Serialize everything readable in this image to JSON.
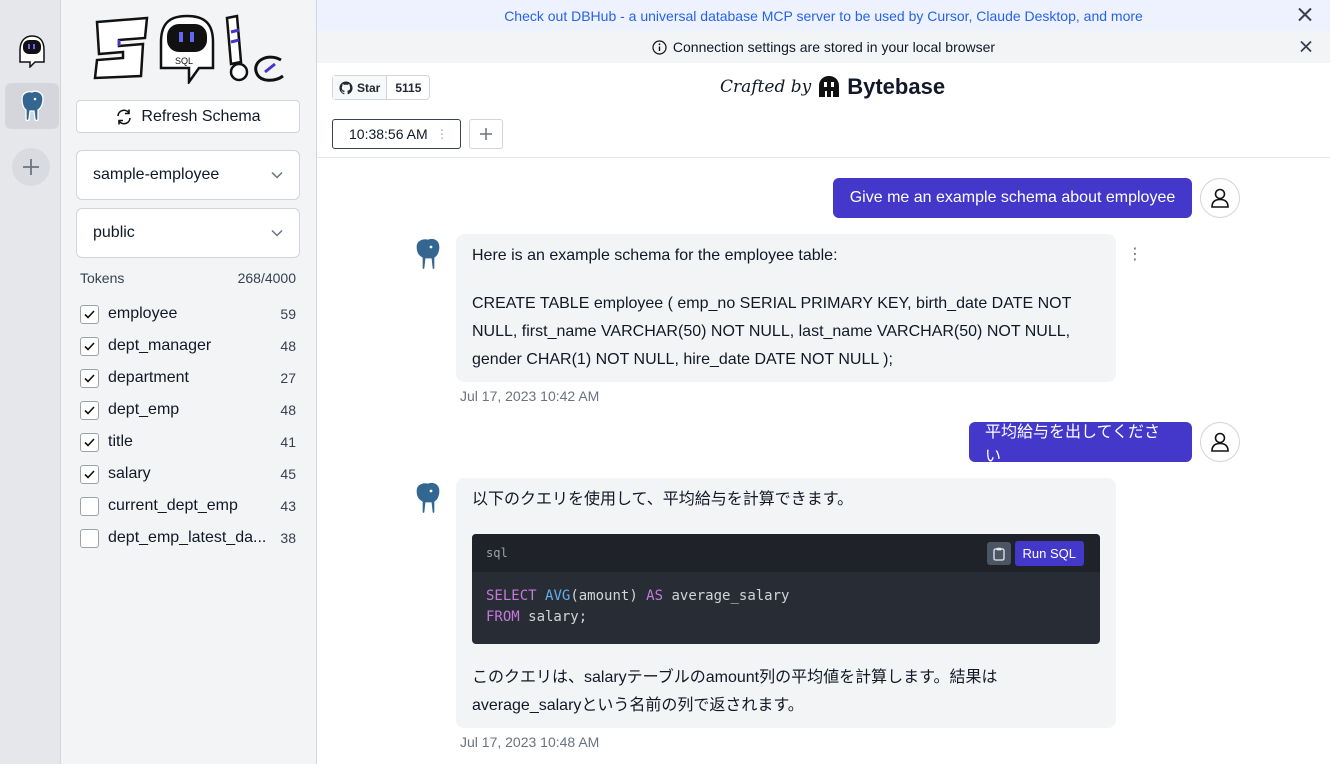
{
  "rail": {
    "items": [
      {
        "name": "sqlchat-bot-icon",
        "active": false
      },
      {
        "name": "postgres-elephant-icon",
        "active": true
      }
    ]
  },
  "sidebar": {
    "refresh_label": "Refresh Schema",
    "database_select": "sample-employee",
    "schema_select": "public",
    "tokens_label": "Tokens",
    "tokens_value": "268/4000",
    "tables": [
      {
        "name": "employee",
        "count": "59",
        "checked": true
      },
      {
        "name": "dept_manager",
        "count": "48",
        "checked": true
      },
      {
        "name": "department",
        "count": "27",
        "checked": true
      },
      {
        "name": "dept_emp",
        "count": "48",
        "checked": true
      },
      {
        "name": "title",
        "count": "41",
        "checked": true
      },
      {
        "name": "salary",
        "count": "45",
        "checked": true
      },
      {
        "name": "current_dept_emp",
        "count": "43",
        "checked": false
      },
      {
        "name": "dept_emp_latest_da...",
        "count": "38",
        "checked": false
      }
    ]
  },
  "banners": {
    "promo": "Check out DBHub - a universal database MCP server to be used by Cursor, Claude Desktop, and more",
    "info": "Connection settings are stored in your local browser"
  },
  "header": {
    "star_label": "Star",
    "star_count": "5115",
    "crafted_by": "Crafted by",
    "brand": "Bytebase"
  },
  "tabs": [
    {
      "label": "10:38:56 AM"
    }
  ],
  "messages": {
    "user1": "Give me an example schema about employee",
    "bot1": {
      "p1": "Here is an example schema for the employee table:",
      "p2": "CREATE TABLE employee ( emp_no SERIAL PRIMARY KEY, birth_date DATE NOT NULL, first_name VARCHAR(50) NOT NULL, last_name VARCHAR(50) NOT NULL, gender CHAR(1) NOT NULL, hire_date DATE NOT NULL );",
      "time": "Jul 17, 2023 10:42 AM"
    },
    "user2": "平均給与を出してください",
    "bot2": {
      "p1": "以下のクエリを使用して、平均給与を計算できます。",
      "code_lang": "sql",
      "run_label": "Run SQL",
      "p2": "このクエリは、salaryテーブルのamount列の平均値を計算します。結果はaverage_salaryという名前の列で返されます。",
      "time": "Jul 17, 2023 10:48 AM"
    }
  },
  "colors": {
    "accent": "#4338ca",
    "banner_text": "#2563eb"
  }
}
